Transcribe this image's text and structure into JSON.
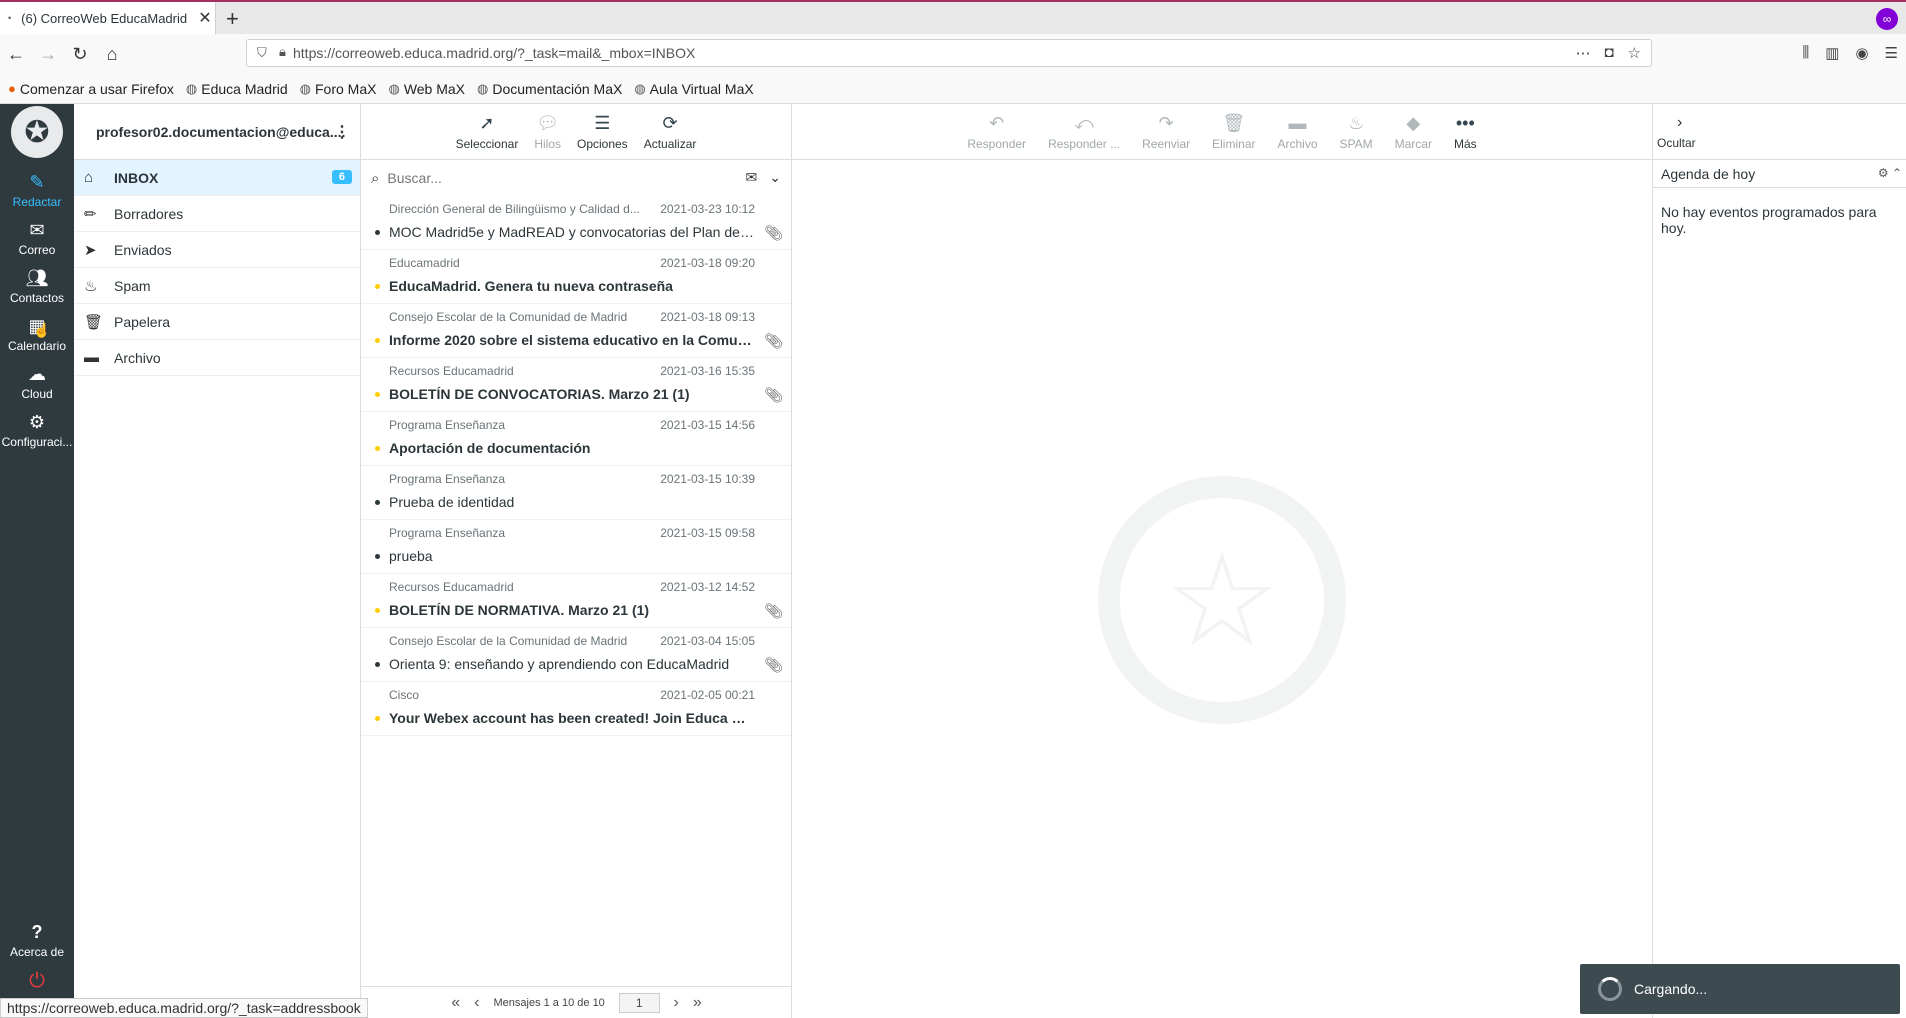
{
  "browser": {
    "tab_title": "(6) CorreoWeb EducaMadrid",
    "tab_indicator": "•",
    "url": "https://correoweb.educa.madrid.org/?_task=mail&_mbox=INBOX",
    "bookmarks": [
      {
        "label": "Comenzar a usar Firefox",
        "icon": "firefox-icon"
      },
      {
        "label": "Educa Madrid",
        "icon": "globe-icon"
      },
      {
        "label": "Foro MaX",
        "icon": "globe-icon"
      },
      {
        "label": "Web MaX",
        "icon": "globe-icon"
      },
      {
        "label": "Documentación MaX",
        "icon": "globe-icon"
      },
      {
        "label": "Aula Virtual MaX",
        "icon": "globe-icon"
      }
    ],
    "status_url": "https://correoweb.educa.madrid.org/?_task=addressbook"
  },
  "leftnav": [
    {
      "label": "Redactar",
      "icon": "compose-icon",
      "active": true
    },
    {
      "label": "Correo",
      "icon": "mail-icon"
    },
    {
      "label": "Contactos",
      "icon": "contacts-icon"
    },
    {
      "label": "Calendario",
      "icon": "calendar-icon"
    },
    {
      "label": "Cloud",
      "icon": "cloud-icon"
    },
    {
      "label": "Configuraci...",
      "icon": "gear-icon"
    }
  ],
  "leftnav_bottom": {
    "about_label": "Acerca de"
  },
  "folders": {
    "account": "profesor02.documentacion@educa....",
    "items": [
      {
        "label": "INBOX",
        "icon": "inbox-icon",
        "count": "6"
      },
      {
        "label": "Borradores",
        "icon": "pencil-icon"
      },
      {
        "label": "Enviados",
        "icon": "send-icon"
      },
      {
        "label": "Spam",
        "icon": "fire-icon"
      },
      {
        "label": "Papelera",
        "icon": "trash-icon"
      },
      {
        "label": "Archivo",
        "icon": "archive-icon"
      }
    ]
  },
  "list_toolbar": {
    "select": "Seleccionar",
    "threads": "Hilos",
    "options": "Opciones",
    "refresh": "Actualizar"
  },
  "search": {
    "placeholder": "Buscar..."
  },
  "messages": [
    {
      "from": "Dirección General de Bilingüismo y Calidad d...",
      "date": "2021-03-23 10:12",
      "subject": "MOC Madrid5e y MadREAD y convocatorias del Plan de F...",
      "unread": false,
      "attachment": true
    },
    {
      "from": "Educamadrid",
      "date": "2021-03-18 09:20",
      "subject": "EducaMadrid. Genera tu nueva contraseña",
      "unread": true,
      "attachment": false
    },
    {
      "from": "Consejo Escolar de la Comunidad de Madrid",
      "date": "2021-03-18 09:13",
      "subject": "Informe 2020 sobre el sistema educativo en la Comunid...",
      "unread": true,
      "attachment": true
    },
    {
      "from": "Recursos Educamadrid",
      "date": "2021-03-16 15:35",
      "subject": "BOLETÍN DE CONVOCATORIAS. Marzo 21 (1)",
      "unread": true,
      "attachment": true
    },
    {
      "from": "Programa Enseñanza",
      "date": "2021-03-15 14:56",
      "subject": "Aportación de documentación",
      "unread": true,
      "attachment": false
    },
    {
      "from": "Programa Enseñanza",
      "date": "2021-03-15 10:39",
      "subject": "Prueba de identidad",
      "unread": false,
      "attachment": false
    },
    {
      "from": "Programa Enseñanza",
      "date": "2021-03-15 09:58",
      "subject": "prueba",
      "unread": false,
      "attachment": false
    },
    {
      "from": "Recursos Educamadrid",
      "date": "2021-03-12 14:52",
      "subject": "BOLETÍN DE NORMATIVA. Marzo 21 (1)",
      "unread": true,
      "attachment": true
    },
    {
      "from": "Consejo Escolar de la Comunidad de Madrid",
      "date": "2021-03-04 15:05",
      "subject": "Orienta 9: enseñando y aprendiendo con EducaMadrid",
      "unread": false,
      "attachment": true
    },
    {
      "from": "Cisco",
      "date": "2021-02-05 00:21",
      "subject": "Your Webex account has been created! Join Educa Madri...",
      "unread": true,
      "attachment": false
    }
  ],
  "pager": {
    "label": "Mensajes 1 a 10 de 10",
    "page": "1"
  },
  "msg_toolbar": {
    "reply": "Responder",
    "reply_all": "Responder ...",
    "forward": "Reenviar",
    "delete": "Eliminar",
    "archive": "Archivo",
    "spam": "SPAM",
    "mark": "Marcar",
    "more": "Más"
  },
  "sidebar": {
    "hide_label": "Ocultar",
    "agenda_title": "Agenda de hoy",
    "agenda_empty": "No hay eventos programados para hoy."
  },
  "loading": {
    "label": "Cargando..."
  },
  "colors": {
    "accent": "#37beff",
    "nav_bg": "#2f3a3f",
    "unread_flag": "#ffcd00"
  }
}
